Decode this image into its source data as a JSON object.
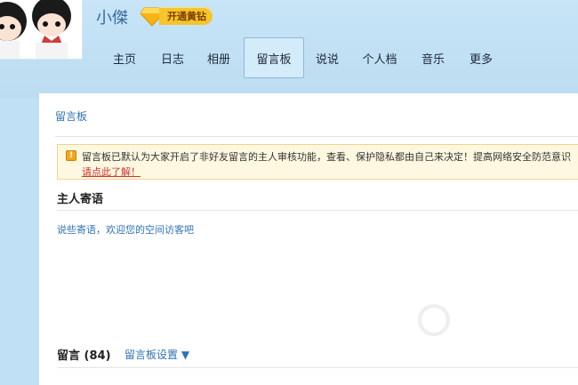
{
  "header": {
    "username": "小傑",
    "vip_label": "开通黄钻"
  },
  "nav": {
    "items": [
      {
        "label": "主页",
        "active": false
      },
      {
        "label": "日志",
        "active": false
      },
      {
        "label": "相册",
        "active": false
      },
      {
        "label": "留言板",
        "active": true
      },
      {
        "label": "说说",
        "active": false
      },
      {
        "label": "个人档",
        "active": false
      },
      {
        "label": "音乐",
        "active": false
      },
      {
        "label": "更多",
        "active": false
      }
    ]
  },
  "panel": {
    "title": "留言板",
    "notice": {
      "text": "留言板已默认为大家开启了非好友留言的主人审核功能，查看、保护隐私都由自己来决定！提高网络安全防范意识",
      "link": "请点此了解！"
    },
    "host": {
      "title": "主人寄语",
      "message": "说些寄语，欢迎您的空间访客吧"
    },
    "messages": {
      "title": "留言",
      "count": "(84)",
      "settings": "留言板设置 ▼"
    }
  },
  "colors": {
    "background": "#bfe0f5",
    "link": "#2e73b6",
    "vip": "#f6c42b",
    "notice_bg": "#fff8e0"
  }
}
